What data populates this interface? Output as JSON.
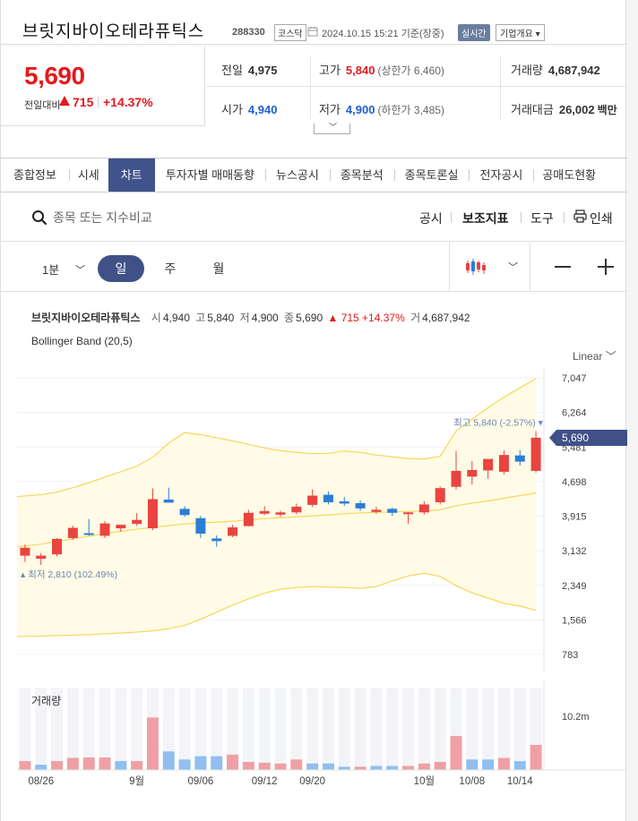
{
  "header": {
    "stock_name": "브릿지바이오테라퓨틱스",
    "stock_code": "288330",
    "market": "코스닥",
    "timestamp": "2024.10.15 15:21",
    "timestamp_suffix": "기준(장중)",
    "realtime_label": "실시간",
    "overview_label": "기업개요 ▾"
  },
  "price": {
    "current": "5,690",
    "prev_label": "전일대비",
    "change": "715",
    "change_pct": "+14.37%"
  },
  "stats": {
    "prev_close_label": "전일",
    "prev_close": "4,975",
    "high_label": "고가",
    "high": "5,840",
    "upper_limit": "(상한가 6,460)",
    "volume_label": "거래량",
    "volume": "4,687,942",
    "open_label": "시가",
    "open": "4,940",
    "low_label": "저가",
    "low": "4,900",
    "lower_limit": "(하한가 3,485)",
    "amount_label": "거래대금",
    "amount": "26,002",
    "amount_unit": "백만"
  },
  "tabs": [
    "종합정보",
    "시세",
    "차트",
    "투자자별 매매동향",
    "뉴스공시",
    "종목분석",
    "종목토론실",
    "전자공시",
    "공매도현황"
  ],
  "active_tab": 2,
  "toolbar": {
    "search_placeholder": "종목 또는 지수비교",
    "disclosure": "공시",
    "indicator": "보조지표",
    "tools": "도구",
    "print": "인쇄"
  },
  "period": {
    "minute": "1분",
    "day": "일",
    "week": "주",
    "month": "월"
  },
  "chart_info": {
    "name": "브릿지바이오테라퓨틱스",
    "o_label": "시",
    "o": "4,940",
    "h_label": "고",
    "h": "5,840",
    "l_label": "저",
    "l": "4,900",
    "c_label": "종",
    "c": "5,690",
    "chg": "▲ 715 +14.37%",
    "v_label": "거",
    "v": "4,687,942"
  },
  "indicator_label": "Bollinger Band (20,5)",
  "scale_label": "Linear",
  "colors": {
    "up": "#e9443f",
    "down": "#2b7ed6",
    "accent": "#3f5187",
    "band_fill": "#fffbe6",
    "band_line": "#f5d75a"
  },
  "chart_data": {
    "type": "candlestick",
    "ylim": [
      783,
      7047
    ],
    "y_ticks": [
      "7,047",
      "6,264",
      "5,481",
      "4,698",
      "3,915",
      "3,132",
      "2,349",
      "1,566",
      "783"
    ],
    "y_tick_values": [
      7047,
      6264,
      5481,
      4698,
      3915,
      3132,
      2349,
      1566,
      783
    ],
    "x_labels": [
      "08/26",
      "9월",
      "09/06",
      "09/12",
      "09/20",
      "10월",
      "10/08",
      "10/14"
    ],
    "x_label_index": [
      1,
      7,
      11,
      15,
      18,
      25,
      28,
      31
    ],
    "current_price_label": "5,690",
    "max_label": "최고 5,840 (-2.57%)",
    "min_label": "최저 2,810 (102.49%)",
    "candles": [
      {
        "o": 3020,
        "h": 3270,
        "l": 2880,
        "c": 3200
      },
      {
        "o": 2950,
        "h": 3080,
        "l": 2810,
        "c": 3020
      },
      {
        "o": 3050,
        "h": 3420,
        "l": 3000,
        "c": 3400
      },
      {
        "o": 3420,
        "h": 3700,
        "l": 3380,
        "c": 3650
      },
      {
        "o": 3530,
        "h": 3850,
        "l": 3470,
        "c": 3500
      },
      {
        "o": 3470,
        "h": 3800,
        "l": 3420,
        "c": 3750
      },
      {
        "o": 3640,
        "h": 3720,
        "l": 3560,
        "c": 3720
      },
      {
        "o": 3740,
        "h": 3980,
        "l": 3700,
        "c": 3830
      },
      {
        "o": 3640,
        "h": 4540,
        "l": 3600,
        "c": 4300
      },
      {
        "o": 4290,
        "h": 4560,
        "l": 4220,
        "c": 4220
      },
      {
        "o": 4080,
        "h": 4140,
        "l": 3900,
        "c": 3940
      },
      {
        "o": 3870,
        "h": 3920,
        "l": 3420,
        "c": 3520
      },
      {
        "o": 3410,
        "h": 3480,
        "l": 3220,
        "c": 3350
      },
      {
        "o": 3470,
        "h": 3720,
        "l": 3440,
        "c": 3660
      },
      {
        "o": 3690,
        "h": 4060,
        "l": 3680,
        "c": 3990
      },
      {
        "o": 3970,
        "h": 4140,
        "l": 3940,
        "c": 4030
      },
      {
        "o": 3950,
        "h": 4040,
        "l": 3900,
        "c": 4000
      },
      {
        "o": 4000,
        "h": 4200,
        "l": 3960,
        "c": 4130
      },
      {
        "o": 4170,
        "h": 4520,
        "l": 4120,
        "c": 4380
      },
      {
        "o": 4400,
        "h": 4470,
        "l": 4180,
        "c": 4230
      },
      {
        "o": 4250,
        "h": 4350,
        "l": 4150,
        "c": 4200
      },
      {
        "o": 4210,
        "h": 4270,
        "l": 4040,
        "c": 4090
      },
      {
        "o": 4010,
        "h": 4130,
        "l": 3970,
        "c": 4060
      },
      {
        "o": 4080,
        "h": 4110,
        "l": 3920,
        "c": 3990
      },
      {
        "o": 3980,
        "h": 4010,
        "l": 3740,
        "c": 4000
      },
      {
        "o": 4000,
        "h": 4250,
        "l": 3950,
        "c": 4180
      },
      {
        "o": 4230,
        "h": 4590,
        "l": 4180,
        "c": 4550
      },
      {
        "o": 4580,
        "h": 5390,
        "l": 4520,
        "c": 4940
      },
      {
        "o": 4810,
        "h": 5160,
        "l": 4630,
        "c": 4960
      },
      {
        "o": 4950,
        "h": 5130,
        "l": 4760,
        "c": 5210
      },
      {
        "o": 4920,
        "h": 5400,
        "l": 4860,
        "c": 5300
      },
      {
        "o": 5290,
        "h": 5410,
        "l": 5060,
        "c": 5150
      },
      {
        "o": 4940,
        "h": 5840,
        "l": 4900,
        "c": 5690
      }
    ],
    "bollinger": {
      "upper": [
        4360,
        4400,
        4460,
        4560,
        4670,
        4800,
        4920,
        5050,
        5250,
        5570,
        5810,
        5760,
        5690,
        5620,
        5540,
        5460,
        5400,
        5360,
        5330,
        5340,
        5390,
        5360,
        5300,
        5260,
        5220,
        5210,
        5270,
        5840,
        6110,
        6370,
        6610,
        6820,
        7030
      ],
      "middle": [
        3220,
        3280,
        3340,
        3400,
        3460,
        3520,
        3570,
        3620,
        3660,
        3700,
        3740,
        3760,
        3780,
        3800,
        3830,
        3860,
        3880,
        3900,
        3920,
        3940,
        3970,
        3990,
        4000,
        4010,
        4020,
        4030,
        4060,
        4150,
        4210,
        4260,
        4320,
        4380,
        4440
      ],
      "lower": [
        1190,
        1200,
        1210,
        1220,
        1230,
        1250,
        1270,
        1290,
        1320,
        1370,
        1440,
        1580,
        1740,
        1900,
        2040,
        2170,
        2260,
        2300,
        2320,
        2310,
        2300,
        2280,
        2320,
        2450,
        2560,
        2620,
        2550,
        2340,
        2180,
        2060,
        1940,
        1880,
        1780
      ]
    },
    "volume_label": "거래량",
    "volume_tick": "10.2m",
    "volume_max": 10200000,
    "volume": [
      1100000,
      650000,
      1100000,
      1500000,
      1550000,
      1550000,
      1100000,
      1100000,
      6500000,
      2300000,
      1300000,
      1700000,
      1700000,
      1900000,
      1000000,
      900000,
      800000,
      1300000,
      800000,
      800000,
      400000,
      400000,
      500000,
      500000,
      500000,
      800000,
      1000000,
      4200000,
      1300000,
      1300000,
      1500000,
      1100000,
      3100000
    ],
    "volume_up": [
      true,
      false,
      true,
      true,
      true,
      true,
      false,
      true,
      true,
      false,
      false,
      false,
      false,
      true,
      true,
      true,
      true,
      true,
      false,
      false,
      false,
      true,
      false,
      false,
      true,
      true,
      true,
      true,
      false,
      false,
      true,
      false,
      true
    ]
  }
}
